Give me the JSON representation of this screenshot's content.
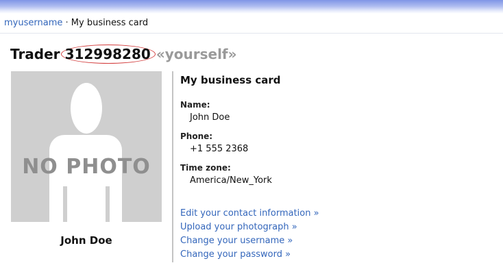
{
  "breadcrumb": {
    "user_link": "myusername",
    "separator": "·",
    "current": "My business card"
  },
  "header": {
    "prefix": "Trader",
    "trader_id": "312998280",
    "yourself": "«yourself»",
    "highlight_color": "#d23b3b"
  },
  "photo": {
    "placeholder_text": "NO PHOTO",
    "caption": "John Doe"
  },
  "card": {
    "title": "My business card",
    "fields": [
      {
        "label": "Name:",
        "value": "John Doe"
      },
      {
        "label": "Phone:",
        "value": "+1 555 2368"
      },
      {
        "label": "Time zone:",
        "value": "America/New_York"
      }
    ]
  },
  "links": [
    {
      "label": "Edit your contact information »"
    },
    {
      "label": "Upload your photograph »"
    },
    {
      "label": "Change your username »"
    },
    {
      "label": "Change your password »"
    }
  ],
  "colors": {
    "link": "#3366bb",
    "topbar": "#7f95e6"
  }
}
